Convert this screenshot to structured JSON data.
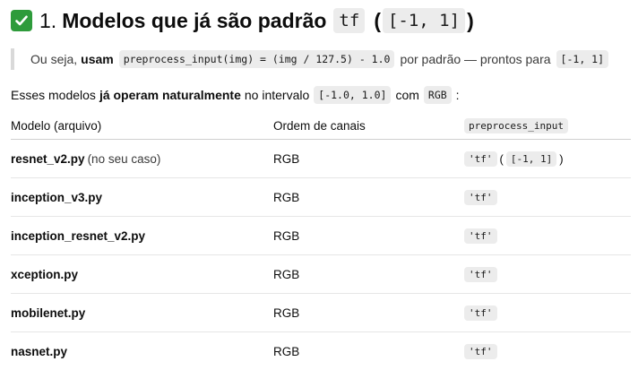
{
  "heading": {
    "number": "1.",
    "title": "Modelos que já são padrão",
    "code": "tf",
    "paren_open": "(",
    "range_code": "[-1, 1]",
    "paren_close": ")"
  },
  "quote": {
    "prefix": "Ou seja,",
    "bold": "usam",
    "code": "preprocess_input(img) = (img / 127.5) - 1.0",
    "middle": "por padrão — prontos para",
    "range_code": "[-1, 1]"
  },
  "intro": {
    "prefix": "Esses modelos",
    "bold": "já operam naturalmente",
    "middle": "no intervalo",
    "range_code": "[-1.0, 1.0]",
    "with": "com",
    "rgb_code": "RGB",
    "suffix": ":"
  },
  "table": {
    "headers": {
      "model": "Modelo (arquivo)",
      "channels": "Ordem de canais",
      "preprocess": "preprocess_input"
    },
    "rows": [
      {
        "file": "resnet_v2.py",
        "note": "(no seu caso)",
        "channels": "RGB",
        "code": "'tf'",
        "extra_open": "(",
        "extra_code": "[-1, 1]",
        "extra_close": ")"
      },
      {
        "file": "inception_v3.py",
        "channels": "RGB",
        "code": "'tf'"
      },
      {
        "file": "inception_resnet_v2.py",
        "channels": "RGB",
        "code": "'tf'"
      },
      {
        "file": "xception.py",
        "channels": "RGB",
        "code": "'tf'"
      },
      {
        "file": "mobilenet.py",
        "channels": "RGB",
        "code": "'tf'"
      },
      {
        "file": "nasnet.py",
        "channels": "RGB",
        "code": "'tf'"
      }
    ]
  },
  "icons": {
    "check": "check-mark-icon"
  },
  "colors": {
    "check_bg": "#2e9b3b",
    "code_bg": "#ececec"
  }
}
